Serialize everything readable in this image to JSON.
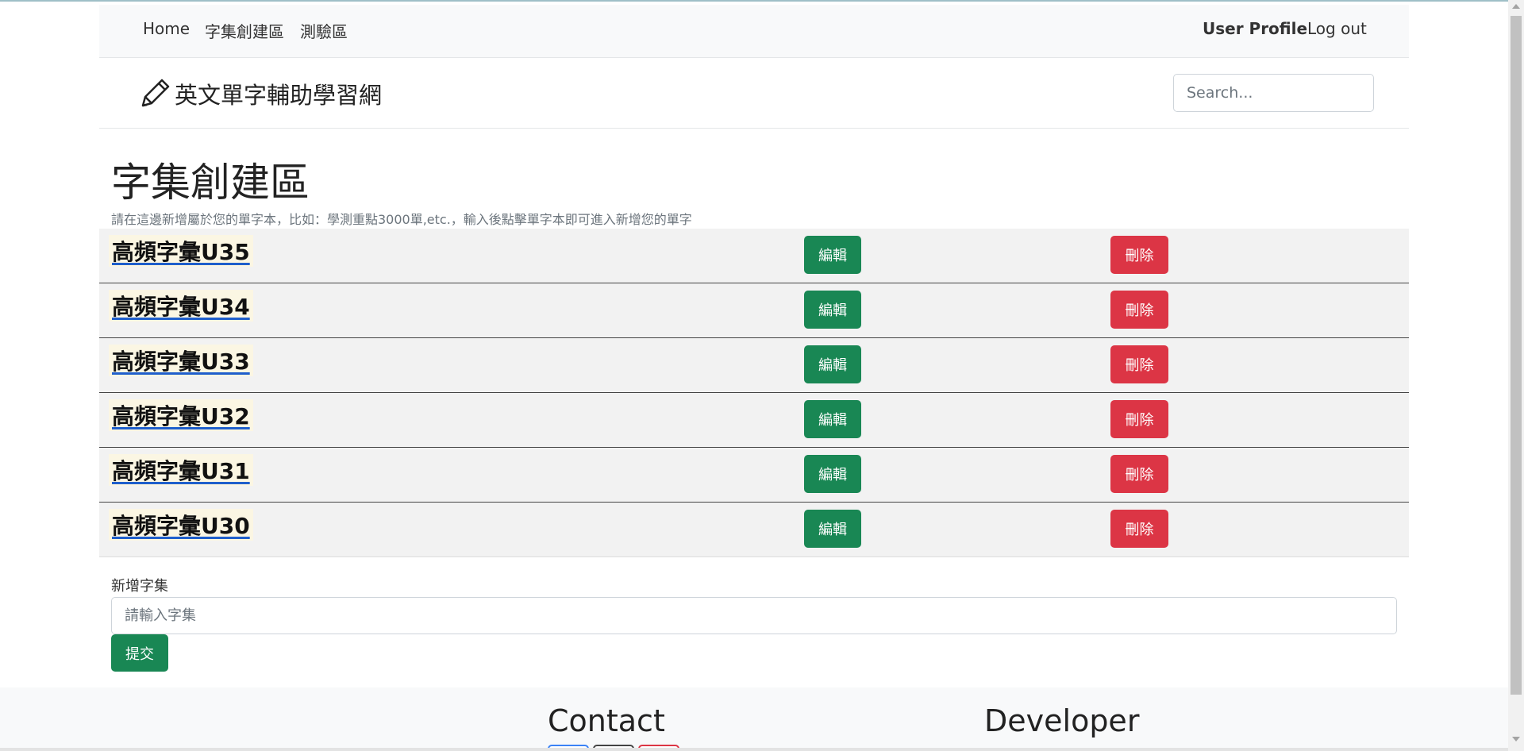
{
  "nav": {
    "home": "Home",
    "wordset_create": "字集創建區",
    "quiz": "測驗區",
    "user_profile": "User Profile",
    "logout": "Log out"
  },
  "brand": {
    "icon": "pencil-icon",
    "title": "英文單字輔助學習網"
  },
  "search": {
    "placeholder": "Search..."
  },
  "main": {
    "title": "字集創建區",
    "description": "請在這邊新增屬於您的單字本，比如：學測重點3000單,etc.，輸入後點擊單字本即可進入新增您的單字"
  },
  "wordsets": [
    {
      "name": "高頻字彙U35",
      "edit_label": "編輯",
      "delete_label": "刪除"
    },
    {
      "name": "高頻字彙U34",
      "edit_label": "編輯",
      "delete_label": "刪除"
    },
    {
      "name": "高頻字彙U33",
      "edit_label": "編輯",
      "delete_label": "刪除"
    },
    {
      "name": "高頻字彙U32",
      "edit_label": "編輯",
      "delete_label": "刪除"
    },
    {
      "name": "高頻字彙U31",
      "edit_label": "編輯",
      "delete_label": "刪除"
    },
    {
      "name": "高頻字彙U30",
      "edit_label": "編輯",
      "delete_label": "刪除"
    }
  ],
  "form": {
    "label": "新增字集",
    "placeholder": "請輸入字集",
    "submit_label": "提交"
  },
  "footer": {
    "contact_title": "Contact",
    "developer_title": "Developer"
  },
  "colors": {
    "edit_button": "#198754",
    "delete_button": "#dc3545",
    "link_underline": "#1f5fcc"
  }
}
